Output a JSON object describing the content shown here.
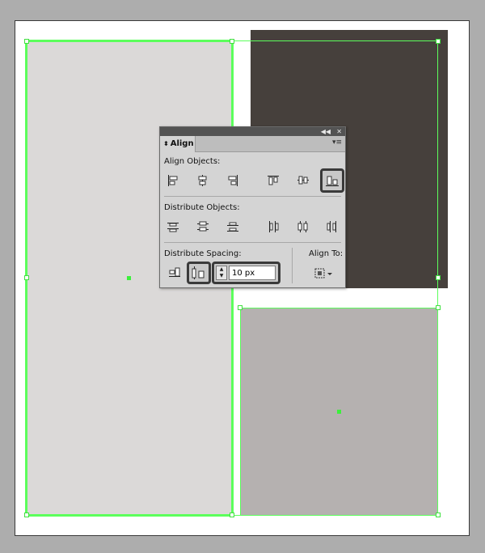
{
  "canvas": {
    "colors": {
      "background": "#adadad",
      "artboard": "#ffffff",
      "left_rect": "#dbd9d8",
      "dark_rect": "#46403c",
      "gray_rect": "#b5b1b0",
      "selection": "#5cff5c"
    }
  },
  "panel": {
    "tab_label": "Align",
    "collapse_icon": "double-chevron-left-icon",
    "close_icon": "close-icon",
    "menu_icon": "panel-menu-icon",
    "sections": {
      "align_objects": {
        "label": "Align Objects:"
      },
      "distribute_objects": {
        "label": "Distribute Objects:"
      },
      "distribute_spacing": {
        "label": "Distribute Spacing:",
        "value": "10 px"
      },
      "align_to": {
        "label": "Align To:"
      }
    }
  }
}
